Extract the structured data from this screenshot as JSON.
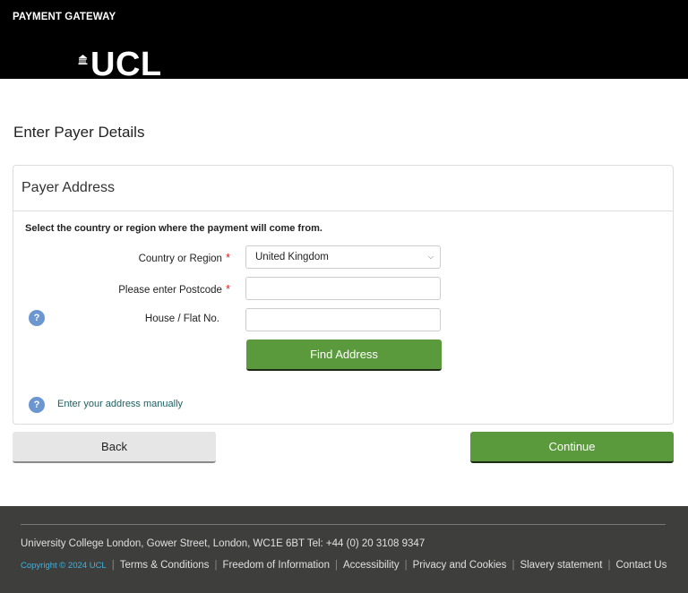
{
  "header": {
    "gateway_label": "PAYMENT GATEWAY",
    "logo_text": "UCL",
    "background_color": "#000000"
  },
  "page": {
    "title": "Enter Payer Details"
  },
  "panel": {
    "heading": "Payer Address",
    "instructions": "Select the country or region where the payment will come from.",
    "fields": {
      "country": {
        "label": "Country or Region",
        "required": true,
        "value": "United Kingdom"
      },
      "postcode": {
        "label": "Please enter Postcode",
        "required": true,
        "value": "",
        "placeholder": ""
      },
      "house": {
        "label": "House / Flat No.",
        "required": false,
        "value": "",
        "placeholder": ""
      }
    },
    "required_marker": "*",
    "help_icon_glyph": "?",
    "find_address_label": "Find Address",
    "manual_link": "Enter your address manually"
  },
  "actions": {
    "back_label": "Back",
    "continue_label": "Continue"
  },
  "footer": {
    "address": "University College London, Gower Street, London, WC1E 6BT Tel: +44 (0) 20 3108 9347",
    "copyright": "Copyright © 2024 UCL",
    "separator": "|",
    "links": [
      "Terms & Conditions",
      "Freedom of Information",
      "Accessibility",
      "Privacy and Cookies",
      "Slavery statement",
      "Contact Us"
    ]
  },
  "colors": {
    "primary_green": "#5a9a3c",
    "help_blue": "#6b96d0",
    "required_red": "#e02020",
    "link_teal": "#1f5e5e",
    "footer_bg": "#3e3e3c",
    "copyright_blue": "#3fb3e0"
  }
}
